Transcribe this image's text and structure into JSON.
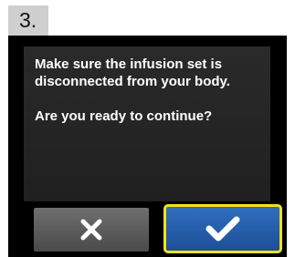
{
  "step": {
    "number": "3."
  },
  "dialog": {
    "lines": [
      "Make sure the infusion set is",
      "disconnected from your body.",
      "Are you ready to continue?"
    ]
  },
  "buttons": {
    "cancel": {
      "icon": "close-icon"
    },
    "confirm": {
      "icon": "checkmark-icon"
    }
  },
  "colors": {
    "confirm_border": "#f5e21a",
    "confirm_fill": "#2f6fbf",
    "screen_bg": "#000000"
  }
}
